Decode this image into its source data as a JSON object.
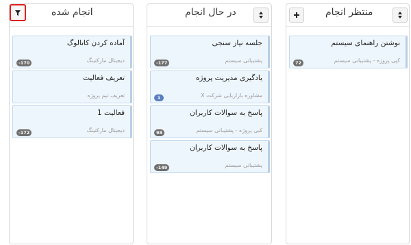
{
  "columns": [
    {
      "title": "انجام شده",
      "button": "filter-icon",
      "cards": [
        {
          "title": "آماده کردن کاتالوگ",
          "subtitle": "دیجیتال مارکتینگ",
          "badge": "-170"
        },
        {
          "title": "تعریف فعالیت",
          "subtitle": "تعریف تیم پروژه",
          "badge": ""
        },
        {
          "title": "فعالیت 1",
          "subtitle": "دیجیتال مارکتینگ",
          "badge": "-172"
        }
      ]
    },
    {
      "title": "در حال انجام",
      "button": "sort-icon",
      "cards": [
        {
          "title": "جلسه نیاز سنجی",
          "subtitle": "پشتیبانی سیستم",
          "badge": "-177"
        },
        {
          "title": "یادگیری مدیریت پروژه",
          "subtitle": "مشاوره بازاریابی شرکت X",
          "badge": "1"
        },
        {
          "title": "پاسخ به سوالات کاربران",
          "subtitle": "کبی پروژه - پشتیبانی سیستم",
          "badge": "98"
        },
        {
          "title": "پاسخ به سوالات کاربران",
          "subtitle": "پشتیبانی سیستم",
          "badge": "-149"
        }
      ]
    },
    {
      "title": "منتظر انجام",
      "buttons": [
        "add-icon",
        "sort-icon"
      ],
      "cards": [
        {
          "title": "نوشتن راهنمای سیستم",
          "subtitle": "کپی پروژه - پشتیبانی سیستم",
          "badge": "72"
        }
      ]
    }
  ],
  "colors": {
    "highlight": "#e01e1e",
    "card_bg": "#eef6fd",
    "badge": "#6f6f6f",
    "badge_blue": "#5a7fc0"
  }
}
